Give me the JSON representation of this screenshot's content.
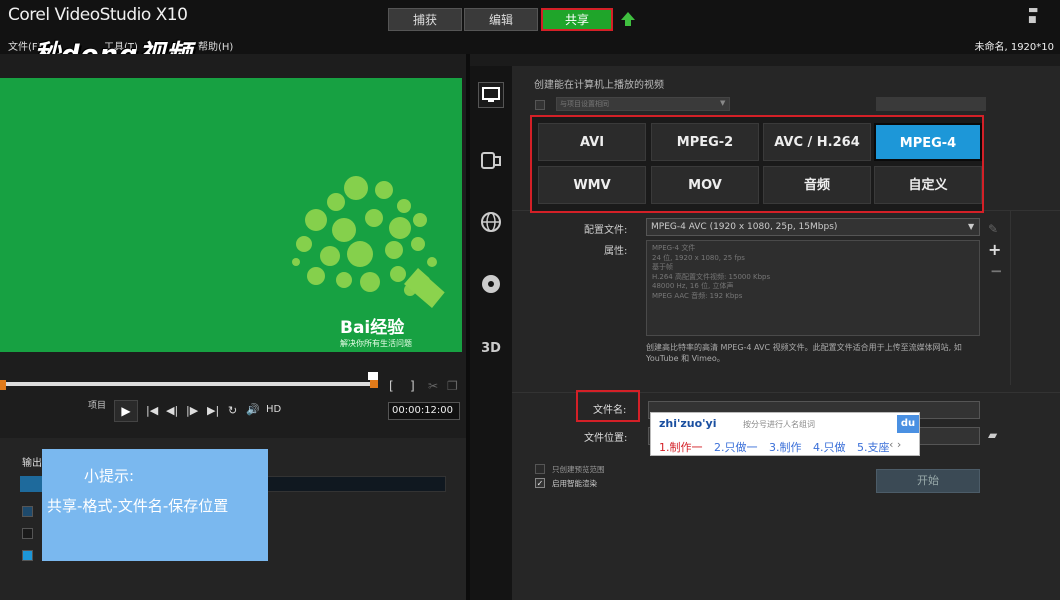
{
  "app": {
    "title": "Corel VideoStudio X10",
    "project_info": "未命名, 1920*10",
    "watermark": "秒dong视频"
  },
  "tabs": [
    {
      "label": "捕获"
    },
    {
      "label": "编辑"
    },
    {
      "label": "共享"
    }
  ],
  "menu": [
    {
      "label": "文件(F)"
    },
    {
      "label": "工具(T)"
    },
    {
      "label": "帮助(H)"
    }
  ],
  "window_controls": {
    "minimize": "▬",
    "restore": "■"
  },
  "preview": {
    "logo_text": "Bai经验",
    "logo_sub": "解决你所有生活问题",
    "project_label": "项目",
    "play": "▶",
    "transport": [
      "|◀",
      "◀|",
      "|▶",
      "▶|",
      "↻",
      "🔊",
      "HD"
    ],
    "timecode": "00:00:12:00",
    "bracket_in": "[",
    "bracket_out": "]",
    "scissors": "✂",
    "copy": "❐"
  },
  "output": {
    "label": "输出"
  },
  "tip": {
    "title": "小提示:",
    "body": "共享-格式-文件名-保存位置"
  },
  "side_icons": [
    {
      "name": "computer-icon",
      "glyph": "🖵"
    },
    {
      "name": "device-icon",
      "glyph": "📱"
    },
    {
      "name": "web-icon",
      "glyph": "🌐"
    },
    {
      "name": "disc-icon",
      "glyph": "💿"
    },
    {
      "name": "3d-icon",
      "glyph": "3D"
    }
  ],
  "share": {
    "heading": "创建能在计算机上播放的视频",
    "disabled_option": "与项目设置相同",
    "formats": [
      {
        "label": "AVI",
        "selected": false
      },
      {
        "label": "MPEG-2",
        "selected": false
      },
      {
        "label": "AVC / H.264",
        "selected": false
      },
      {
        "label": "MPEG-4",
        "selected": true
      },
      {
        "label": "WMV",
        "selected": false
      },
      {
        "label": "MOV",
        "selected": false
      },
      {
        "label": "音频",
        "selected": false
      },
      {
        "label": "自定义",
        "selected": false
      }
    ],
    "profile_label": "配置文件:",
    "profile_value": "MPEG-4 AVC (1920 x 1080, 25p, 15Mbps)",
    "properties_label": "属性:",
    "properties": [
      "MPEG-4 文件",
      "24 位, 1920 x 1080, 25 fps",
      "基于帧",
      "H.264 高配置文件视频: 15000 Kbps",
      "48000 Hz, 16 位, 立体声",
      "MPEG AAC 音频: 192 Kbps"
    ],
    "description": "创建高比特率的高清 MPEG-4 AVC 视频文件。此配置文件适合用于上传至流媒体网站, 如 YouTube 和 Vimeo。",
    "filename_label": "文件名:",
    "filename_value": "",
    "filepath_label": "文件位置:",
    "filepath_value": "",
    "checkbox1": "只创建预览范围",
    "checkbox2": "启用智能渲染",
    "start_label": "开始"
  },
  "ime": {
    "input": "zhi'zuo'yi",
    "hint": "按分号进行人名组词",
    "du": "du",
    "candidates": [
      "1.制作一",
      "2.只做一",
      "3.制作",
      "4.只做",
      "5.支座"
    ],
    "nav": "‹  ›"
  },
  "colors": {
    "accent": "#1fa52a",
    "highlight": "#d42027",
    "selected_format": "#1d97d8",
    "tip_bg": "#7ab8ef",
    "preview_bg": "#17a142"
  }
}
